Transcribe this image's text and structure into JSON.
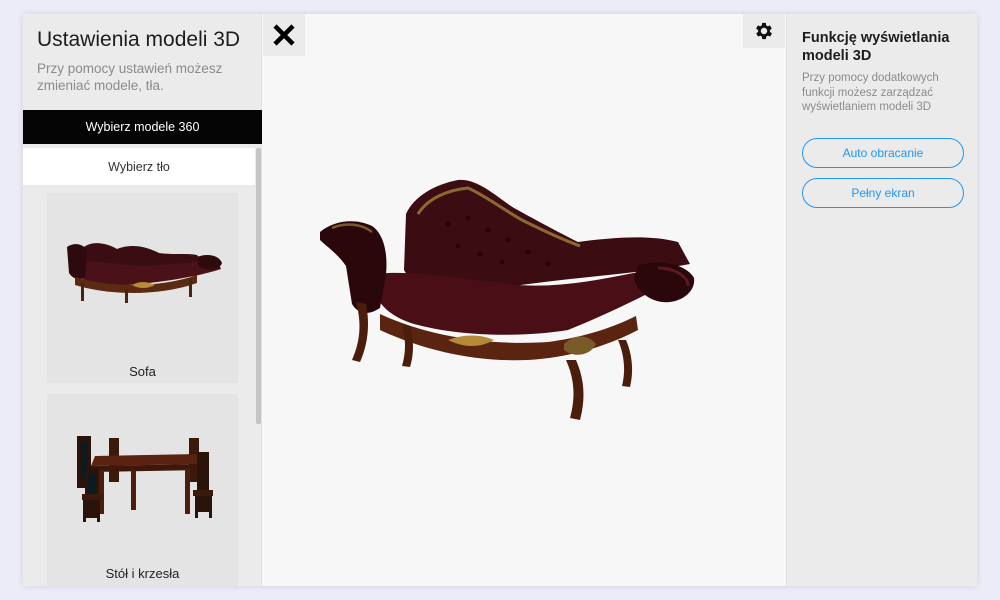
{
  "left_panel": {
    "title": "Ustawienia modeli 3D",
    "description": "Przy pomocy ustawień możesz zmieniać modele, tła.",
    "choose_models_label": "Wybierz modele 360",
    "choose_background_label": "Wybierz tło",
    "models": [
      {
        "label": "Sofa",
        "icon": "sofa-thumbnail"
      },
      {
        "label": "Stół i krzesła",
        "icon": "table-chairs-thumbnail"
      }
    ]
  },
  "viewer": {
    "close_icon": "close-icon",
    "settings_icon": "gear-icon",
    "model_icon": "sofa-3d-model"
  },
  "right_panel": {
    "title": "Funkcję wyświetlania modeli 3D",
    "description": "Przy pomocy dodatkowych funkcji możesz zarządzać wyświetlaniem modeli 3D",
    "auto_rotate_label": "Auto obracanie",
    "fullscreen_label": "Pełny ekran"
  },
  "colors": {
    "accent": "#2196f3",
    "active_button_bg": "#050505",
    "panel_bg": "#ebebeb",
    "viewer_bg": "#f7f7f7"
  }
}
